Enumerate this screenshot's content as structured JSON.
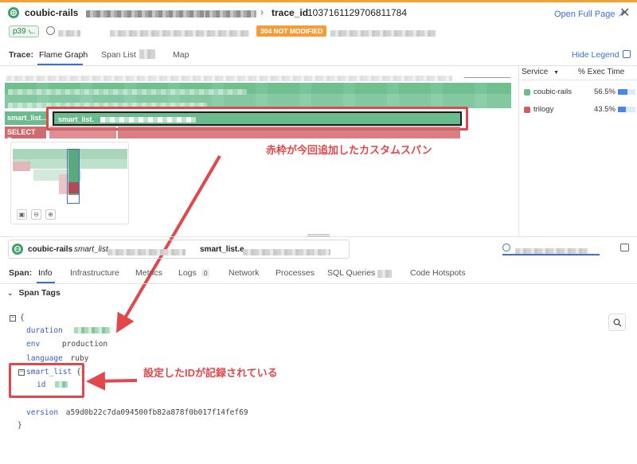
{
  "header": {
    "service": "coubic-rails",
    "trace_label": "trace_id",
    "trace_id": "1037161129706811784",
    "open_full_page": "Open Full Page",
    "percentile": "p39",
    "status": "304 NOT MODIFIED"
  },
  "tabs": {
    "label": "Trace:",
    "items": [
      "Flame Graph",
      "Span List",
      "Map"
    ],
    "active": "Flame Graph",
    "hide_legend": "Hide Legend"
  },
  "flame": {
    "span_left_label": "smart_list...",
    "span_main_label": "smart_list.",
    "select_label": "SELECT D..."
  },
  "legend": {
    "service_header": "Service",
    "exec_header": "% Exec Time",
    "rows": [
      {
        "name": "coubic-rails",
        "pct": "56.5%",
        "fraction": 0.565,
        "color": "#6cbb8e"
      },
      {
        "name": "trilogy",
        "pct": "43.5%",
        "fraction": 0.435,
        "color": "#c96068"
      }
    ]
  },
  "annotations": {
    "custom_span": "赤枠が今回追加したカスタムスパン",
    "id_recorded": "設定したIDが記録されている"
  },
  "span_panel": {
    "service": "coubic-rails",
    "resource": "smart_list.",
    "name": "smart_list.e",
    "label": "Span:",
    "tabs": [
      {
        "label": "Info",
        "count": ""
      },
      {
        "label": "Infrastructure",
        "count": ""
      },
      {
        "label": "Metrics",
        "count": ""
      },
      {
        "label": "Logs",
        "count": "0"
      },
      {
        "label": "Network",
        "count": ""
      },
      {
        "label": "Processes",
        "count": ""
      },
      {
        "label": "SQL Queries",
        "count": ""
      },
      {
        "label": "Code Hotspots",
        "count": ""
      }
    ],
    "section_title": "Span Tags"
  },
  "tags": {
    "open_brace": "{",
    "close_brace": "}",
    "duration_key": "duration",
    "env_key": "env",
    "env_val": "production",
    "language_key": "language",
    "language_val": "ruby",
    "smart_list_key": "smart_list",
    "smart_list_open": "{",
    "id_key": "id",
    "version_key": "version",
    "version_val": "a59d0b22c7da094500fb82a878f0b017f14fef69"
  },
  "colors": {
    "accent": "#3b6fd3",
    "brand_green": "#3f9e6b",
    "highlight_red": "#e2474b",
    "status_orange": "#f29d38"
  }
}
